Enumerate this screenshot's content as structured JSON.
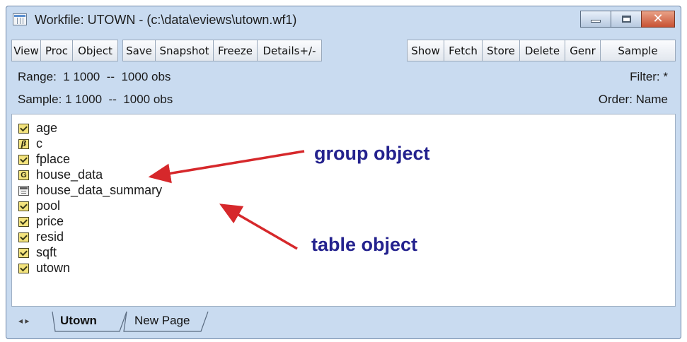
{
  "window": {
    "title": "Workfile: UTOWN - (c:\\data\\eviews\\utown.wf1)",
    "controls": {
      "minimize": "minimize-icon",
      "maximize": "maximize-icon",
      "close": "close-icon"
    }
  },
  "toolbar": {
    "buttons": [
      "View",
      "Proc",
      "Object",
      "Save",
      "Snapshot",
      "Freeze",
      "Details+/-",
      "Show",
      "Fetch",
      "Store",
      "Delete",
      "Genr",
      "Sample"
    ]
  },
  "info": {
    "range": "Range:  1 1000  --  1000 obs",
    "sample": "Sample: 1 1000  --  1000 obs",
    "filter": "Filter: *",
    "order": "Order: Name"
  },
  "objects": [
    {
      "name": "age",
      "icon": "series-icon"
    },
    {
      "name": "c",
      "icon": "coefficient-icon",
      "glyph": "β"
    },
    {
      "name": "fplace",
      "icon": "series-icon"
    },
    {
      "name": "house_data",
      "icon": "group-icon",
      "glyph": "G"
    },
    {
      "name": "house_data_summary",
      "icon": "table-icon"
    },
    {
      "name": "pool",
      "icon": "series-icon"
    },
    {
      "name": "price",
      "icon": "series-icon"
    },
    {
      "name": "resid",
      "icon": "series-icon"
    },
    {
      "name": "sqft",
      "icon": "series-icon"
    },
    {
      "name": "utown",
      "icon": "series-icon"
    }
  ],
  "annotations": {
    "group": "group object",
    "table": "table object",
    "color": "#24228e",
    "arrow_color": "#d6282b"
  },
  "tabs": {
    "nav": "◂ ▸",
    "items": [
      "Utown",
      "New Page"
    ],
    "active": "Utown"
  }
}
